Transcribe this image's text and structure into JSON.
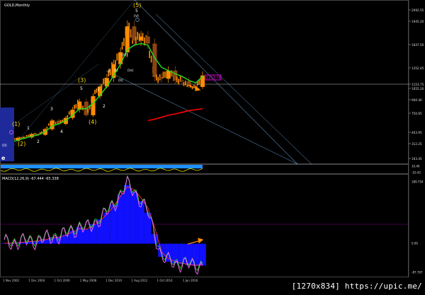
{
  "app": {
    "symbol_title": "GOLD,Monthly"
  },
  "colors": {
    "background": "#000000",
    "candle_up": "#ff8c00",
    "candle_down": "#8b4513",
    "ma_fast": "#22dd22",
    "ma_slow": "#ff0000",
    "channel": "#6fa8dc",
    "hline": "#c8c8c8",
    "wave_label": "#ffd700",
    "wave_label_alt": "#ffffff",
    "price_tag": "#ff00ff",
    "macd_hist": "#1010ff",
    "macd_signal": "#ff3030",
    "macd_line": "#ff66ff",
    "macd_green": "#22dd22",
    "osc_line": "#ffff00",
    "osc_fill": "#1e90ff",
    "orange_arrow": "#ff8c00",
    "box_fill": "#1f2a9a"
  },
  "price_axis": {
    "ticks": [
      "2092.55",
      "1945.20",
      "1647.50",
      "1352.45",
      "1153.75",
      "1055.20",
      "900.40",
      "750.65",
      "463.95",
      "312.25",
      "163.45"
    ],
    "tag_value": "1253.78"
  },
  "osc_axis": {
    "ticks": [
      "10.40",
      "-10.45"
    ]
  },
  "macd_panel": {
    "title": "MACD(12,26,9) -67.444 -65.338",
    "ticks": [
      "189.754",
      "0.00",
      "-87.767"
    ]
  },
  "time_axis": {
    "labels": [
      "1 Nov 2002",
      "1 Dec 2004",
      "1 Oct 2006",
      "1 May 2008",
      "1 Dec 2010",
      "1 Aug 2012",
      "1 Oct 2014",
      "1 Jun 2016"
    ]
  },
  "wave_labels": {
    "w1": "(1)",
    "w2": "(2)",
    "w3": "(3)",
    "w4": "(4)",
    "w5": "(5)",
    "s1": "1",
    "s2": "2",
    "s3": "3",
    "s4": "4",
    "s5": "5",
    "r1": "1",
    "r2": "2",
    "r3": "3",
    "i": "(i)",
    "ii": "(ii)",
    "iii": "(iii)",
    "iv": "(iv)",
    "v": "(v)",
    "top5": "5",
    "left_e": "e"
  },
  "watermark": "[1270x834] https://upic.me/",
  "chart_data": {
    "type": "candlestick",
    "title": "GOLD,Monthly",
    "xlabel": "",
    "ylabel": "",
    "x": [
      "2002-11",
      "2003-05",
      "2003-11",
      "2004-05",
      "2004-12",
      "2005-06",
      "2005-12",
      "2006-05",
      "2006-10",
      "2007-04",
      "2007-10",
      "2008-05",
      "2008-11",
      "2009-06",
      "2009-12",
      "2010-06",
      "2010-12",
      "2011-05",
      "2011-09",
      "2012-02",
      "2012-08",
      "2013-01",
      "2013-06",
      "2013-12",
      "2014-06",
      "2014-10",
      "2015-03",
      "2015-08",
      "2016-01",
      "2016-06"
    ],
    "series": [
      {
        "values": [
          320,
          350,
          390,
          395,
          440,
          430,
          510,
          640,
          590,
          680,
          790,
          880,
          720,
          950,
          1100,
          1230,
          1400,
          1550,
          1880,
          1700,
          1750,
          1660,
          1240,
          1220,
          1320,
          1200,
          1190,
          1110,
          1090,
          1260
        ]
      }
    ],
    "ylim": [
      163.45,
      2092.55
    ],
    "yticks": [
      2092.55,
      1945.2,
      1647.5,
      1352.45,
      1153.75,
      1055.2,
      900.4,
      750.65,
      463.95,
      312.25,
      163.45
    ],
    "last_price_tag": 1253.78,
    "grid": false,
    "legend": "none",
    "indicators": [
      {
        "type": "line",
        "values": [
          300,
          330,
          360,
          385,
          410,
          430,
          470,
          560,
          590,
          640,
          720,
          800,
          800,
          860,
          960,
          1100,
          1260,
          1400,
          1580,
          1640,
          1660,
          1640,
          1480,
          1360,
          1320,
          1280,
          1250,
          1200,
          1170,
          1250
        ]
      },
      {
        "type": "line",
        "values": [
          null,
          null,
          null,
          null,
          null,
          null,
          null,
          null,
          null,
          null,
          null,
          null,
          null,
          null,
          null,
          null,
          null,
          null,
          null,
          null,
          null,
          640,
          660,
          690,
          720,
          740,
          760,
          780,
          790,
          800
        ]
      }
    ],
    "macd": {
      "ylim": [
        -87.767,
        189.754
      ],
      "yticks": [
        189.754,
        0.0,
        -87.767
      ],
      "histogram": [
        2,
        3,
        4,
        6,
        8,
        10,
        14,
        20,
        22,
        28,
        40,
        50,
        45,
        60,
        75,
        95,
        120,
        150,
        180,
        160,
        130,
        95,
        30,
        -40,
        -55,
        -60,
        -62,
        -66,
        -68,
        -67
      ],
      "signal": [
        1,
        2,
        3,
        5,
        7,
        9,
        12,
        18,
        20,
        26,
        36,
        46,
        44,
        56,
        70,
        90,
        115,
        145,
        175,
        165,
        140,
        110,
        50,
        -25,
        -45,
        -55,
        -60,
        -64,
        -66,
        -65
      ]
    }
  }
}
